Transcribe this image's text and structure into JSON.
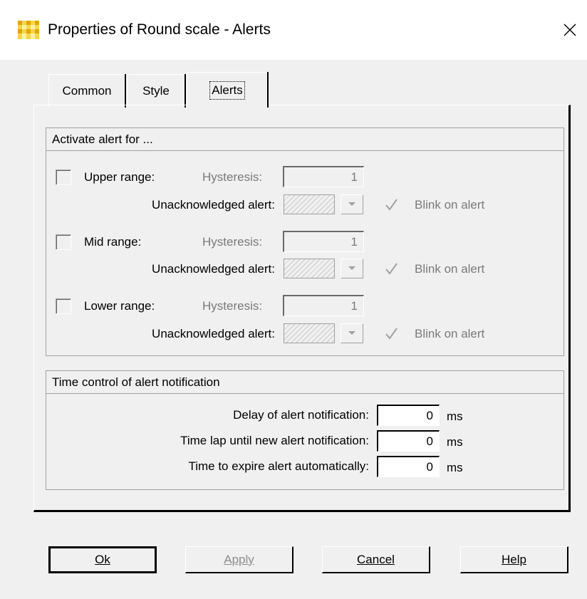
{
  "window": {
    "title": "Properties of Round scale  - Alerts",
    "close_glyph": "✕"
  },
  "tabs": [
    {
      "label": "Common",
      "active": false
    },
    {
      "label": "Style",
      "active": false
    },
    {
      "label": "Alerts",
      "active": true
    }
  ],
  "activate_group": {
    "header": "Activate alert for ...",
    "ranges": [
      {
        "label": "Upper range:",
        "hysteresis_label": "Hysteresis:",
        "hysteresis_value": "1",
        "unack_label": "Unacknowledged alert:",
        "blink_label": "Blink on alert",
        "checked": false,
        "blink_checked": true
      },
      {
        "label": "Mid range:",
        "hysteresis_label": "Hysteresis:",
        "hysteresis_value": "1",
        "unack_label": "Unacknowledged alert:",
        "blink_label": "Blink on alert",
        "checked": false,
        "blink_checked": true
      },
      {
        "label": "Lower range:",
        "hysteresis_label": "Hysteresis:",
        "hysteresis_value": "1",
        "unack_label": "Unacknowledged alert:",
        "blink_label": "Blink on alert",
        "checked": false,
        "blink_checked": true
      }
    ]
  },
  "time_group": {
    "header": "Time control of alert notification",
    "rows": [
      {
        "label": "Delay of alert notification:",
        "value": "0",
        "unit": "ms"
      },
      {
        "label": "Time lap until new alert notification:",
        "value": "0",
        "unit": "ms"
      },
      {
        "label": "Time to expire alert automatically:",
        "value": "0",
        "unit": "ms"
      }
    ]
  },
  "buttons": {
    "ok": "Ok",
    "apply": "Apply",
    "cancel": "Cancel",
    "help": "Help"
  },
  "colors": {
    "background": "#f0f0f0",
    "disabled_text": "#7a7a7a",
    "app_icon": "#f5c518"
  }
}
